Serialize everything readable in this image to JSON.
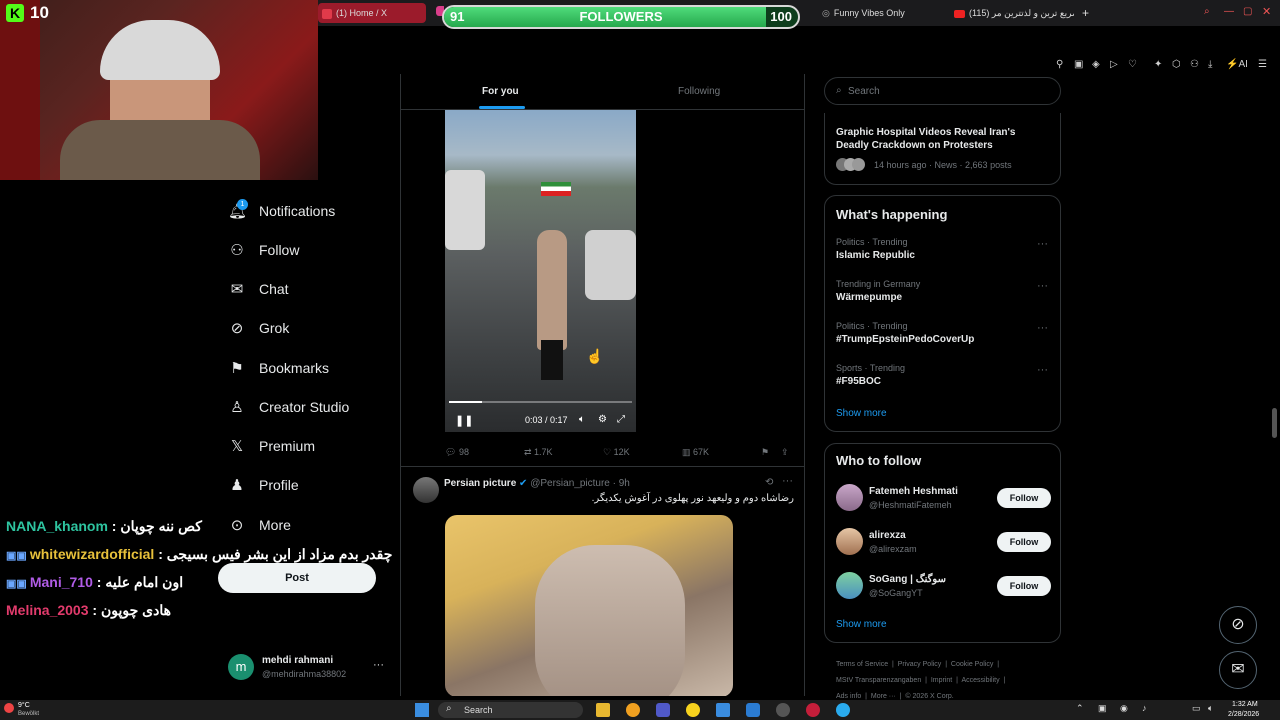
{
  "browser": {
    "tabs": [
      {
        "label": "(1) Home / X"
      },
      {
        "label": "Funny Vibes Only"
      },
      {
        "label": "(115) صریع ترین و لذتترین مر"
      }
    ],
    "new_tab": "+"
  },
  "overlay": {
    "kick_count": "10",
    "followers_label": "FOLLOWERS",
    "followers_current": "91",
    "followers_goal": "100",
    "followers_progress": 0.91,
    "fill_color": "#37c463"
  },
  "sidebar": {
    "items": [
      {
        "label": "Notifications",
        "badge": "1"
      },
      {
        "label": "Follow"
      },
      {
        "label": "Chat"
      },
      {
        "label": "Grok"
      },
      {
        "label": "Bookmarks"
      },
      {
        "label": "Creator Studio"
      },
      {
        "label": "Premium"
      },
      {
        "label": "Profile"
      },
      {
        "label": "More"
      }
    ],
    "post_label": "Post",
    "account": {
      "name": "mehdi rahmani",
      "handle": "@mehdirahma38802",
      "initial": "m"
    }
  },
  "chat": [
    {
      "user": "NANA_khanom",
      "message": "کص ننه چوپان",
      "color": "#2ec4a0"
    },
    {
      "user": "whitewizardofficial",
      "message": "چقدر بدم مزاد از این بشر فیس بسیجی",
      "color": "#e8c13b"
    },
    {
      "user": "Mani_710",
      "message": "اون امام علیه",
      "color": "#b05ce6"
    },
    {
      "user": "Melina_2003",
      "message": "هادی چوپون",
      "color": "#e23b6c"
    }
  ],
  "feed": {
    "tabs": [
      {
        "label": "For you"
      },
      {
        "label": "Following"
      }
    ],
    "video": {
      "time": "0:03 / 0:17",
      "progress": 0.18
    },
    "actions": {
      "replies": "98",
      "reposts": "1.7K",
      "likes": "12K",
      "views": "67K"
    },
    "tweet2": {
      "name": "Persian picture",
      "handle": "@Persian_picture",
      "time": "· 9h",
      "text": "رضاشاه دوم و ولیعهد نور پهلوی در آغوش یکدیگر."
    }
  },
  "right": {
    "search_placeholder": "Search",
    "news": {
      "title": "Graphic Hospital Videos Reveal Iran's Deadly Crackdown on Protesters",
      "meta": "14 hours ago · News · 2,663 posts"
    },
    "happening": {
      "title": "What's happening",
      "trends": [
        {
          "meta": "Politics · Trending",
          "name": "Islamic Republic"
        },
        {
          "meta": "Trending in Germany",
          "name": "Wärmepumpe"
        },
        {
          "meta": "Politics · Trending",
          "name": "#TrumpEpsteinPedoCoverUp"
        },
        {
          "meta": "Sports · Trending",
          "name": "#F95BOC"
        }
      ],
      "show_more": "Show more"
    },
    "who_to_follow": {
      "title": "Who to follow",
      "users": [
        {
          "name": "Fatemeh Heshmati",
          "handle": "@HeshmatiFatemeh"
        },
        {
          "name": "alirexza",
          "handle": "@alirexzam"
        },
        {
          "name": "SoGang | سوگنگ",
          "handle": "@SoGangYT"
        }
      ],
      "follow_label": "Follow",
      "show_more": "Show more"
    },
    "footer": [
      "Terms of Service",
      "Privacy Policy",
      "Cookie Policy",
      "Imprint",
      "Accessibility",
      "MStV Transparenzangaben",
      "Ads info",
      "More ···",
      "© 2026 X Corp."
    ]
  },
  "taskbar": {
    "weather_temp": "9°C",
    "weather_desc": "Bewölkt",
    "search": "Search",
    "time": "1:32 AM",
    "date": "2/28/2026"
  }
}
